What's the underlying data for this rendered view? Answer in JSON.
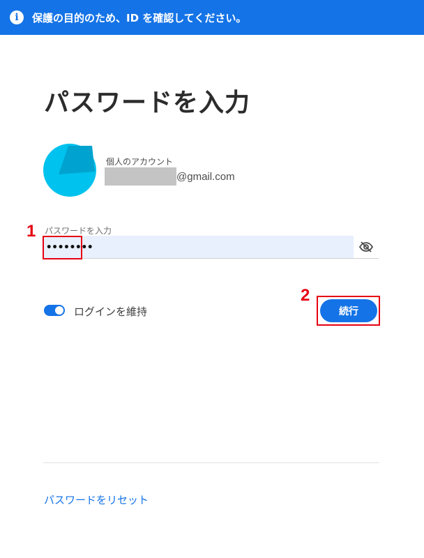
{
  "banner": {
    "icon": "info-icon",
    "text": "保護の目的のため、ID を確認してください。"
  },
  "title": "パスワードを入力",
  "account": {
    "label": "個人のアカウント",
    "email_suffix": "@gmail.com"
  },
  "password": {
    "label": "パスワードを入力",
    "value": "••••••••",
    "toggle_icon": "eye-slash-icon"
  },
  "annotations": {
    "step1": "1",
    "step2": "2"
  },
  "keep_signed_in": {
    "label": "ログインを維持",
    "enabled": true
  },
  "continue_label": "続行",
  "reset_link": "パスワードをリセット",
  "colors": {
    "accent": "#1473e6",
    "annotation": "#e60012",
    "avatar_light": "#00c2ee",
    "avatar_dark": "#00a3cf"
  }
}
